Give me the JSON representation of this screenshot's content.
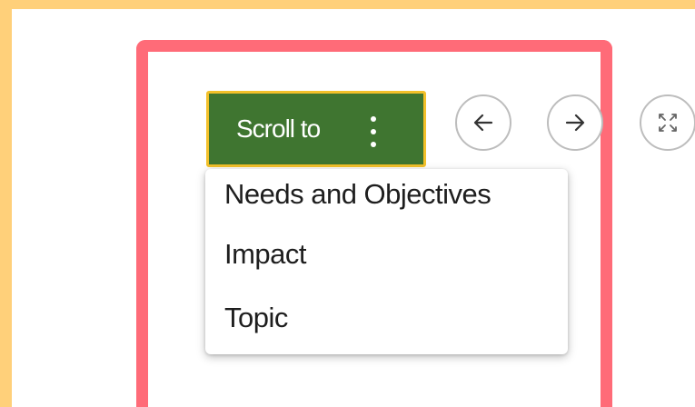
{
  "toolbar": {
    "scroll_to_label": "Scroll to",
    "prev_icon": "arrow-left-icon",
    "next_icon": "arrow-right-icon",
    "fullscreen_icon": "expand-icon"
  },
  "menu": {
    "items": [
      {
        "label": "Needs and Objectives"
      },
      {
        "label": "Impact"
      },
      {
        "label": "Topic"
      }
    ]
  },
  "colors": {
    "frame": "#ffd07a",
    "highlight": "#ff6b78",
    "button_bg": "#3f7530",
    "button_border": "#f2c02a"
  }
}
